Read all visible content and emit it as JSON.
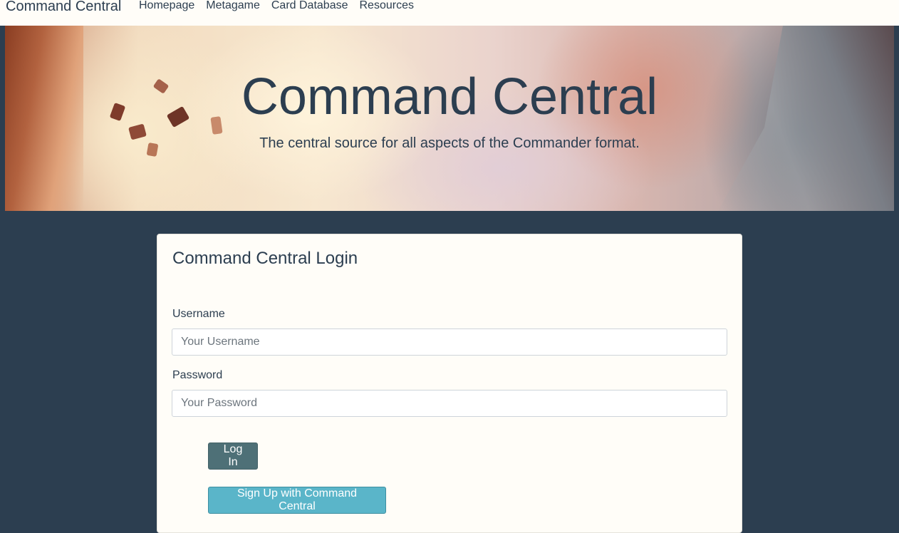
{
  "navbar": {
    "brand": "Command Central",
    "links": [
      "Homepage",
      "Metagame",
      "Card Database",
      "Resources"
    ]
  },
  "hero": {
    "title": "Command Central",
    "subtitle": "The central source for all aspects of the Commander format."
  },
  "login": {
    "title": "Command Central Login",
    "username_label": "Username",
    "username_placeholder": "Your Username",
    "username_value": "",
    "password_label": "Password",
    "password_placeholder": "Your Password",
    "password_value": "",
    "login_button": "Log In",
    "signup_button": "Sign Up with Command Central"
  },
  "colors": {
    "page_background": "#2c3e50",
    "navbar_background": "#fffdf8",
    "text_primary": "#2c3e50",
    "login_button": "#4e7077",
    "signup_button": "#5ab5c9"
  }
}
